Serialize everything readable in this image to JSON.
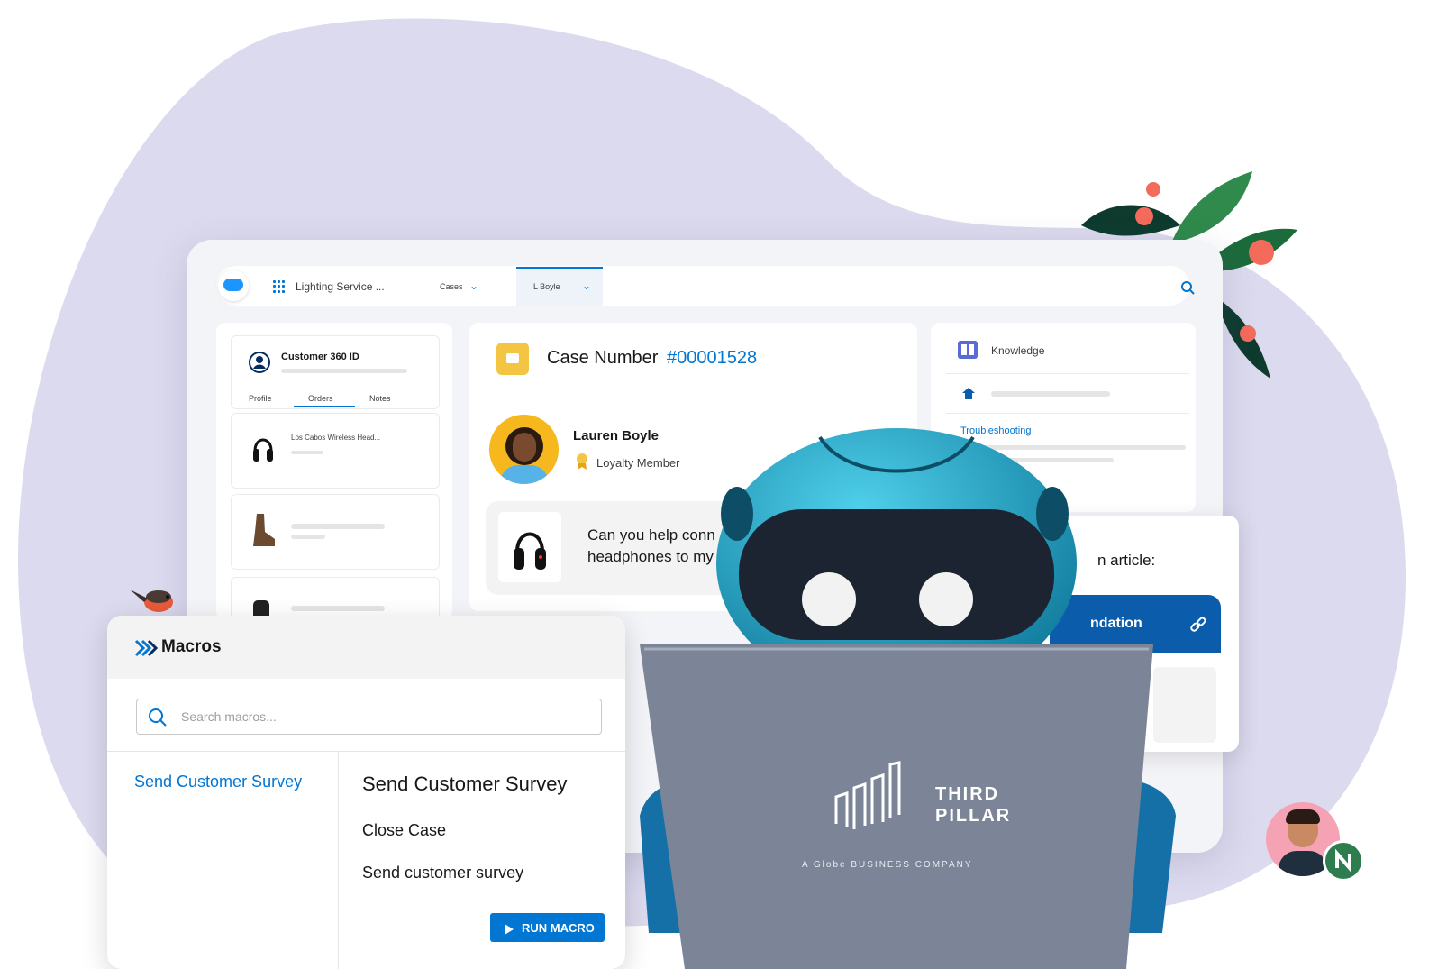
{
  "console": {
    "app_name": "Lighting Service ...",
    "tab_cases": "Cases",
    "tab_person": "L Boyle"
  },
  "customer_panel": {
    "title": "Customer 360 ID",
    "tabs": [
      "Profile",
      "Orders",
      "Notes"
    ],
    "order_item": "Los Cabos Wireless Head..."
  },
  "case": {
    "label": "Case Number",
    "number": "#00001528",
    "customer_name": "Lauren Boyle",
    "customer_status": "Loyalty Member",
    "message_line1": "Can you help conn",
    "message_line2": "headphones to my"
  },
  "knowledge": {
    "title": "Knowledge",
    "link": "Troubleshooting"
  },
  "recommendation": {
    "partial_text": "n article:",
    "button_label": "ndation"
  },
  "macros": {
    "title": "Macros",
    "search_placeholder": "Search macros...",
    "list_item": "Send Customer Survey",
    "detail_title": "Send Customer Survey",
    "steps": [
      "Close Case",
      "Send customer survey"
    ],
    "run_label": "RUN MACRO"
  },
  "laptop_brand": {
    "line1": "THIRD",
    "line2": "PILLAR",
    "tagline": "A  Globe BUSINESS COMPANY"
  },
  "colors": {
    "brand_blue": "#0176d3",
    "backdrop_lavender": "#dcdaee",
    "robot_teal": "#1fa7c9"
  },
  "icons": [
    "salesforce-cloud-icon",
    "app-launcher-icon",
    "search-icon",
    "customer-360-icon",
    "headphones-icon",
    "case-icon",
    "loyalty-badge-icon",
    "knowledge-icon",
    "link-icon",
    "macros-chevron-icon",
    "play-icon"
  ]
}
